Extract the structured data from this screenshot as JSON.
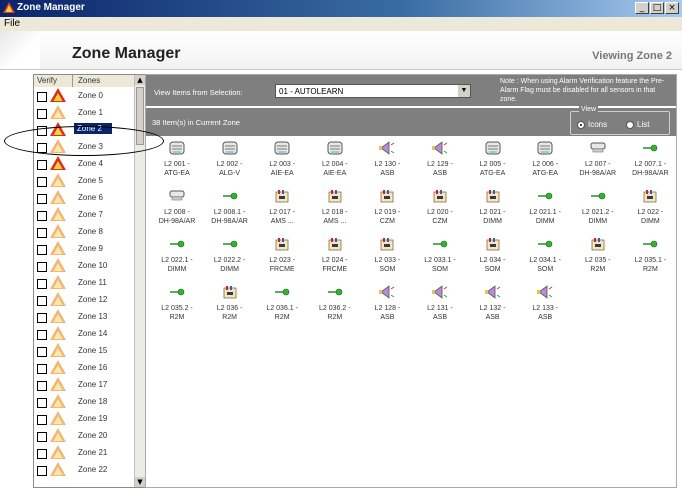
{
  "window": {
    "title": "Zone Manager",
    "menu_file": "File"
  },
  "header": {
    "title": "Zone Manager",
    "viewing": "Viewing Zone 2"
  },
  "zones": {
    "col_verify": "Verify",
    "col_zones": "Zones",
    "selected": "Zone 2",
    "items": [
      {
        "label": "Zone 0",
        "style": "red"
      },
      {
        "label": "Zone 1",
        "style": "light"
      },
      {
        "label": "Zone 2",
        "style": "red"
      },
      {
        "label": "Zone 3",
        "style": "light"
      },
      {
        "label": "Zone 4",
        "style": "red"
      },
      {
        "label": "Zone 5",
        "style": "light"
      },
      {
        "label": "Zone 6",
        "style": "light"
      },
      {
        "label": "Zone 7",
        "style": "light"
      },
      {
        "label": "Zone 8",
        "style": "light"
      },
      {
        "label": "Zone 9",
        "style": "light"
      },
      {
        "label": "Zone 10",
        "style": "light"
      },
      {
        "label": "Zone 11",
        "style": "light"
      },
      {
        "label": "Zone 12",
        "style": "light"
      },
      {
        "label": "Zone 13",
        "style": "light"
      },
      {
        "label": "Zone 14",
        "style": "light"
      },
      {
        "label": "Zone 15",
        "style": "light"
      },
      {
        "label": "Zone 16",
        "style": "light"
      },
      {
        "label": "Zone 17",
        "style": "light"
      },
      {
        "label": "Zone 18",
        "style": "light"
      },
      {
        "label": "Zone 19",
        "style": "light"
      },
      {
        "label": "Zone 20",
        "style": "light"
      },
      {
        "label": "Zone 21",
        "style": "light"
      },
      {
        "label": "Zone 22",
        "style": "light"
      }
    ]
  },
  "selection": {
    "label": "View Items from Selection:",
    "value": "01 - AUTOLEARN",
    "note": "Note : When using Alarm Verification feature the Pre-Alarm Flag must be disabled for all sensors in that zone."
  },
  "count_text": "38 Item(s) in Current Zone",
  "view": {
    "title": "View",
    "icons_label": "Icons",
    "list_label": "List",
    "selected": "Icons"
  },
  "items": [
    {
      "l1": "L2 001 -",
      "l2": "ATG-EA",
      "icon": "smoke-detector-icon"
    },
    {
      "l1": "L2 002 -",
      "l2": "ALG-V",
      "icon": "smoke-detector-icon"
    },
    {
      "l1": "L2 003 -",
      "l2": "AIE-EA",
      "icon": "smoke-detector-icon"
    },
    {
      "l1": "L2 004 -",
      "l2": "AIE-EA",
      "icon": "smoke-detector-icon"
    },
    {
      "l1": "L2 130 -",
      "l2": "ASB",
      "icon": "sounder-icon"
    },
    {
      "l1": "L2 129 -",
      "l2": "ASB",
      "icon": "sounder-icon"
    },
    {
      "l1": "L2 005 -",
      "l2": "ATG-EA",
      "icon": "smoke-detector-icon"
    },
    {
      "l1": "L2 006 -",
      "l2": "ATG-EA",
      "icon": "smoke-detector-icon"
    },
    {
      "l1": "L2 007 -",
      "l2": "DH-98A/AR",
      "icon": "duct-detector-icon"
    },
    {
      "l1": "L2 007.1 -",
      "l2": "DH-98A/AR",
      "icon": "relay-icon"
    },
    {
      "l1": "L2 008 -",
      "l2": "DH-98A/AR",
      "icon": "duct-detector-icon"
    },
    {
      "l1": "L2 008.1 -",
      "l2": "DH-98A/AR",
      "icon": "relay-icon"
    },
    {
      "l1": "L2 017 -",
      "l2": "AMS ...",
      "icon": "module-icon"
    },
    {
      "l1": "L2 018 -",
      "l2": "AMS ...",
      "icon": "module-icon"
    },
    {
      "l1": "L2 019 -",
      "l2": "CZM",
      "icon": "module-icon"
    },
    {
      "l1": "L2 020 -",
      "l2": "CZM",
      "icon": "module-icon"
    },
    {
      "l1": "L2 021 -",
      "l2": "DIMM",
      "icon": "module-icon"
    },
    {
      "l1": "L2 021.1 -",
      "l2": "DIMM",
      "icon": "relay-icon"
    },
    {
      "l1": "L2 021.2 -",
      "l2": "DIMM",
      "icon": "relay-icon"
    },
    {
      "l1": "L2 022 -",
      "l2": "DIMM",
      "icon": "module-icon"
    },
    {
      "l1": "L2 022.1 -",
      "l2": "DIMM",
      "icon": "relay-icon"
    },
    {
      "l1": "L2 022.2 -",
      "l2": "DIMM",
      "icon": "relay-icon"
    },
    {
      "l1": "L2 023 -",
      "l2": "FRCME",
      "icon": "module-icon"
    },
    {
      "l1": "L2 024 -",
      "l2": "FRCME",
      "icon": "module-icon"
    },
    {
      "l1": "L2 033 -",
      "l2": "SOM",
      "icon": "module-icon"
    },
    {
      "l1": "L2 033.1 -",
      "l2": "SOM",
      "icon": "relay-icon"
    },
    {
      "l1": "L2 034 -",
      "l2": "SOM",
      "icon": "module-icon"
    },
    {
      "l1": "L2 034.1 -",
      "l2": "SOM",
      "icon": "relay-icon"
    },
    {
      "l1": "L2 035 -",
      "l2": "R2M",
      "icon": "module-icon"
    },
    {
      "l1": "L2 035.1 -",
      "l2": "R2M",
      "icon": "relay-icon"
    },
    {
      "l1": "L2 035.2 -",
      "l2": "R2M",
      "icon": "relay-icon"
    },
    {
      "l1": "L2 036 -",
      "l2": "R2M",
      "icon": "module-icon"
    },
    {
      "l1": "L2 036.1 -",
      "l2": "R2M",
      "icon": "relay-icon"
    },
    {
      "l1": "L2 036.2 -",
      "l2": "R2M",
      "icon": "relay-icon"
    },
    {
      "l1": "L2 128 -",
      "l2": "ASB",
      "icon": "sounder-icon"
    },
    {
      "l1": "L2 131 -",
      "l2": "ASB",
      "icon": "sounder-icon"
    },
    {
      "l1": "L2 132 -",
      "l2": "ASB",
      "icon": "sounder-icon"
    },
    {
      "l1": "L2 133 -",
      "l2": "ASB",
      "icon": "sounder-icon"
    }
  ]
}
